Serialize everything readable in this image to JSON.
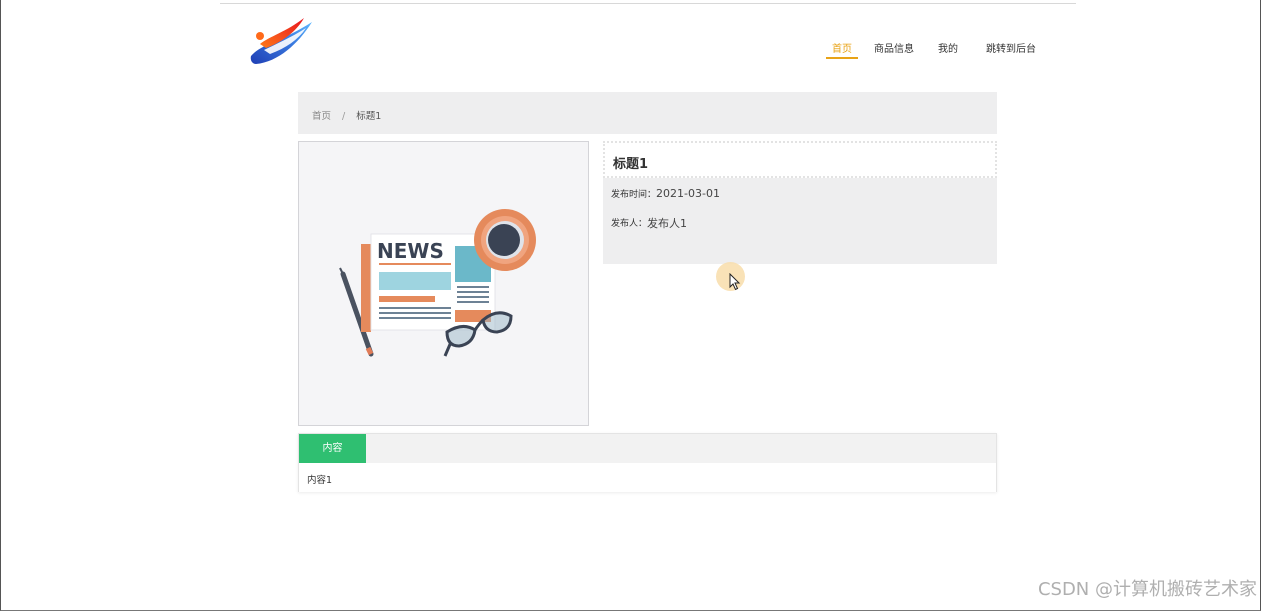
{
  "header": {
    "nav": [
      {
        "label": "首页",
        "active": true
      },
      {
        "label": "商品信息",
        "active": false
      },
      {
        "label": "我的",
        "active": false
      },
      {
        "label": "跳转到后台",
        "active": false
      }
    ],
    "accent_color": "#e8a317"
  },
  "breadcrumb": {
    "home": "首页",
    "separator": "/",
    "current": "标题1"
  },
  "image": {
    "news_text": "NEWS"
  },
  "detail": {
    "title": "标题1",
    "publish_time_label": "发布时间：",
    "publish_time_value": "2021-03-01",
    "publisher_label": "发布人：",
    "publisher_value": "发布人1"
  },
  "tabs": {
    "items": [
      {
        "label": "内容",
        "active": true
      }
    ],
    "content": "内容1",
    "tab_color": "#2fbf71"
  },
  "watermark": "CSDN @计算机搬砖艺术家"
}
